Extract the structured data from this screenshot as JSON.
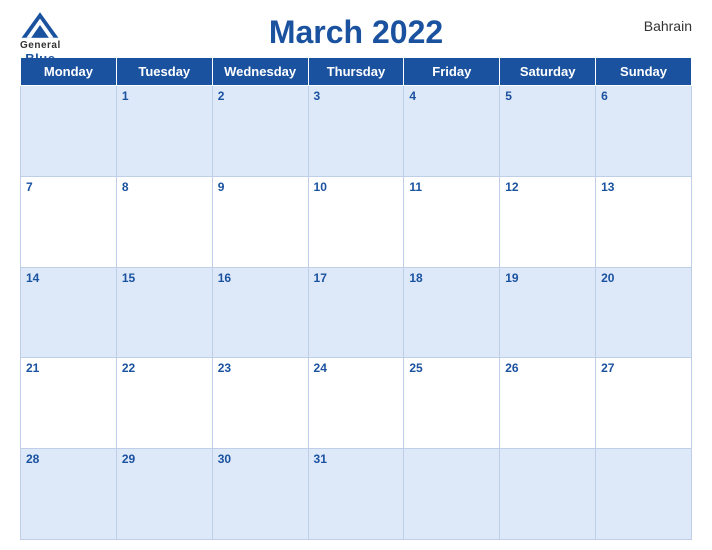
{
  "header": {
    "logo": {
      "general": "General",
      "blue": "Blue"
    },
    "title": "March 2022",
    "country": "Bahrain"
  },
  "days": [
    "Monday",
    "Tuesday",
    "Wednesday",
    "Thursday",
    "Friday",
    "Saturday",
    "Sunday"
  ],
  "weeks": [
    [
      "",
      "1",
      "2",
      "3",
      "4",
      "5",
      "6"
    ],
    [
      "7",
      "8",
      "9",
      "10",
      "11",
      "12",
      "13"
    ],
    [
      "14",
      "15",
      "16",
      "17",
      "18",
      "19",
      "20"
    ],
    [
      "21",
      "22",
      "23",
      "24",
      "25",
      "26",
      "27"
    ],
    [
      "28",
      "29",
      "30",
      "31",
      "",
      "",
      ""
    ]
  ]
}
